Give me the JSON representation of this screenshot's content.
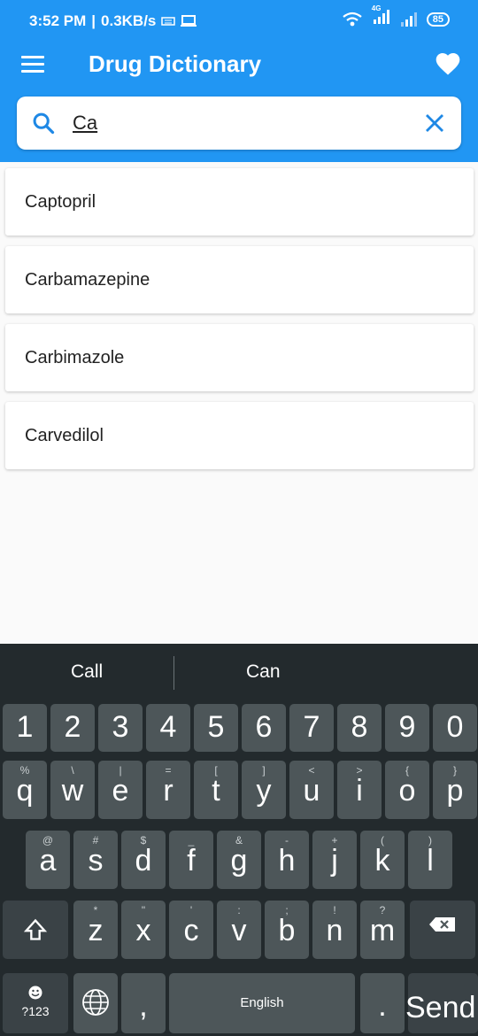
{
  "status_bar": {
    "time": "3:52 PM",
    "speed": "0.3KB/s",
    "network": "4G",
    "battery": "85"
  },
  "app_bar": {
    "title": "Drug Dictionary",
    "menu_icon": "menu-icon",
    "favorite_icon": "heart-icon"
  },
  "search": {
    "value": "Ca",
    "placeholder": ""
  },
  "results": [
    "Captopril",
    "Carbamazepine",
    "Carbimazole",
    "Carvedilol"
  ],
  "keyboard": {
    "suggestions": [
      "Call",
      "Can"
    ],
    "number_row": [
      "1",
      "2",
      "3",
      "4",
      "5",
      "6",
      "7",
      "8",
      "9",
      "0"
    ],
    "row1": [
      {
        "key": "q",
        "sub": "%"
      },
      {
        "key": "w",
        "sub": "\\"
      },
      {
        "key": "e",
        "sub": "|"
      },
      {
        "key": "r",
        "sub": "="
      },
      {
        "key": "t",
        "sub": "["
      },
      {
        "key": "y",
        "sub": "]"
      },
      {
        "key": "u",
        "sub": "<"
      },
      {
        "key": "i",
        "sub": ">"
      },
      {
        "key": "o",
        "sub": "{"
      },
      {
        "key": "p",
        "sub": "}"
      }
    ],
    "row2": [
      {
        "key": "a",
        "sub": "@"
      },
      {
        "key": "s",
        "sub": "#"
      },
      {
        "key": "d",
        "sub": "$"
      },
      {
        "key": "f",
        "sub": "_"
      },
      {
        "key": "g",
        "sub": "&"
      },
      {
        "key": "h",
        "sub": "-"
      },
      {
        "key": "j",
        "sub": "+"
      },
      {
        "key": "k",
        "sub": "("
      },
      {
        "key": "l",
        "sub": ")"
      }
    ],
    "row3": [
      {
        "key": "z",
        "sub": "*"
      },
      {
        "key": "x",
        "sub": "\""
      },
      {
        "key": "c",
        "sub": "'"
      },
      {
        "key": "v",
        "sub": ":"
      },
      {
        "key": "b",
        "sub": ";"
      },
      {
        "key": "n",
        "sub": "!"
      },
      {
        "key": "m",
        "sub": "?"
      }
    ],
    "symbols_label": "?123",
    "comma": ",",
    "space_label": "English",
    "period": ".",
    "send_label": "Send",
    "shift_icon": "shift-icon",
    "backspace_icon": "backspace-icon",
    "globe_icon": "globe-icon",
    "emoji_icon": "emoji-icon"
  }
}
